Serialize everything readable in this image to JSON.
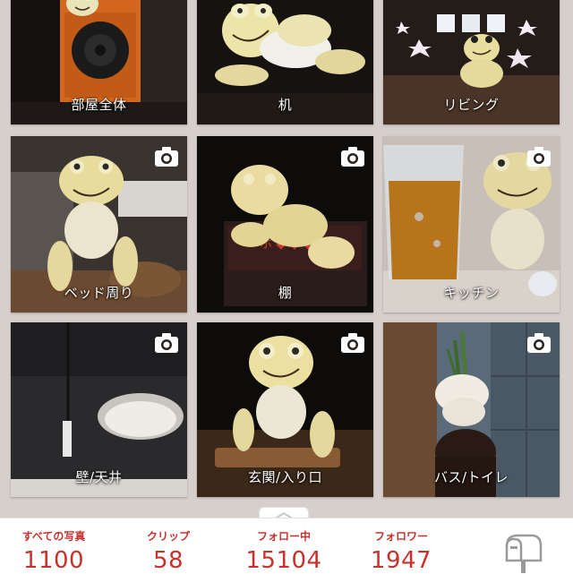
{
  "tiles": [
    {
      "label": "部屋全体",
      "camera": false
    },
    {
      "label": "机",
      "camera": false
    },
    {
      "label": "リビング",
      "camera": false
    },
    {
      "label": "ベッド周り",
      "camera": true
    },
    {
      "label": "棚",
      "camera": true
    },
    {
      "label": "キッチン",
      "camera": true
    },
    {
      "label": "壁/天井",
      "camera": true
    },
    {
      "label": "玄関/入り口",
      "camera": true
    },
    {
      "label": "バス/トイレ",
      "camera": true
    }
  ],
  "stats": [
    {
      "label": "すべての写真",
      "value": "1100"
    },
    {
      "label": "クリップ",
      "value": "58"
    },
    {
      "label": "フォロー中",
      "value": "15104"
    },
    {
      "label": "フォロワー",
      "value": "1947"
    }
  ],
  "colors": {
    "accent": "#c8322c",
    "background": "#d6cfcb"
  },
  "icons": {
    "camera": "camera-icon",
    "mailbox": "mailbox-icon",
    "expand": "chevron-up-icon"
  }
}
